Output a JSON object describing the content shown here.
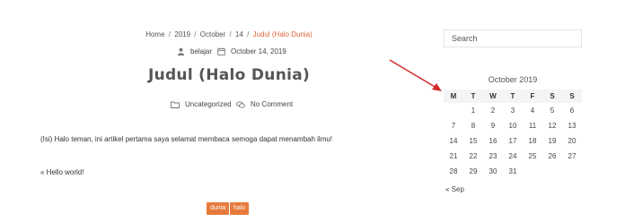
{
  "breadcrumb": {
    "home": "Home",
    "year": "2019",
    "month": "October",
    "day": "14",
    "current": "Judul (Halo Dunia)",
    "separator": "/"
  },
  "post": {
    "author": "belajar",
    "date": "October 14, 2019",
    "title": "Judul (Halo Dunia)",
    "category": "Uncategorized",
    "comments": "No Comment",
    "content": "(Isi) Halo teman, ini artikel pertama saya selamat membaca semoga dapat menambah ilmu!",
    "prev_post": "« Hello world!",
    "tags": [
      "dunia",
      "halo"
    ],
    "tag_color": "#e67a3c"
  },
  "sidebar": {
    "search_placeholder": "Search",
    "calendar": {
      "caption": "October 2019",
      "weekdays": [
        "M",
        "T",
        "W",
        "T",
        "F",
        "S",
        "S"
      ],
      "weeks": [
        [
          "",
          "1",
          "2",
          "3",
          "4",
          "5",
          "6"
        ],
        [
          "7",
          "8",
          "9",
          "10",
          "11",
          "12",
          "13"
        ],
        [
          "14",
          "15",
          "16",
          "17",
          "18",
          "19",
          "20"
        ],
        [
          "21",
          "22",
          "23",
          "24",
          "25",
          "26",
          "27"
        ],
        [
          "28",
          "29",
          "30",
          "31",
          "",
          "",
          ""
        ]
      ],
      "prev_link": "« Sep"
    }
  },
  "annotation": {
    "arrow_color": "#d42a2a"
  },
  "icons": {
    "author": "user-icon",
    "date": "calendar-icon",
    "category": "folder-icon",
    "comments": "comment-icon"
  }
}
